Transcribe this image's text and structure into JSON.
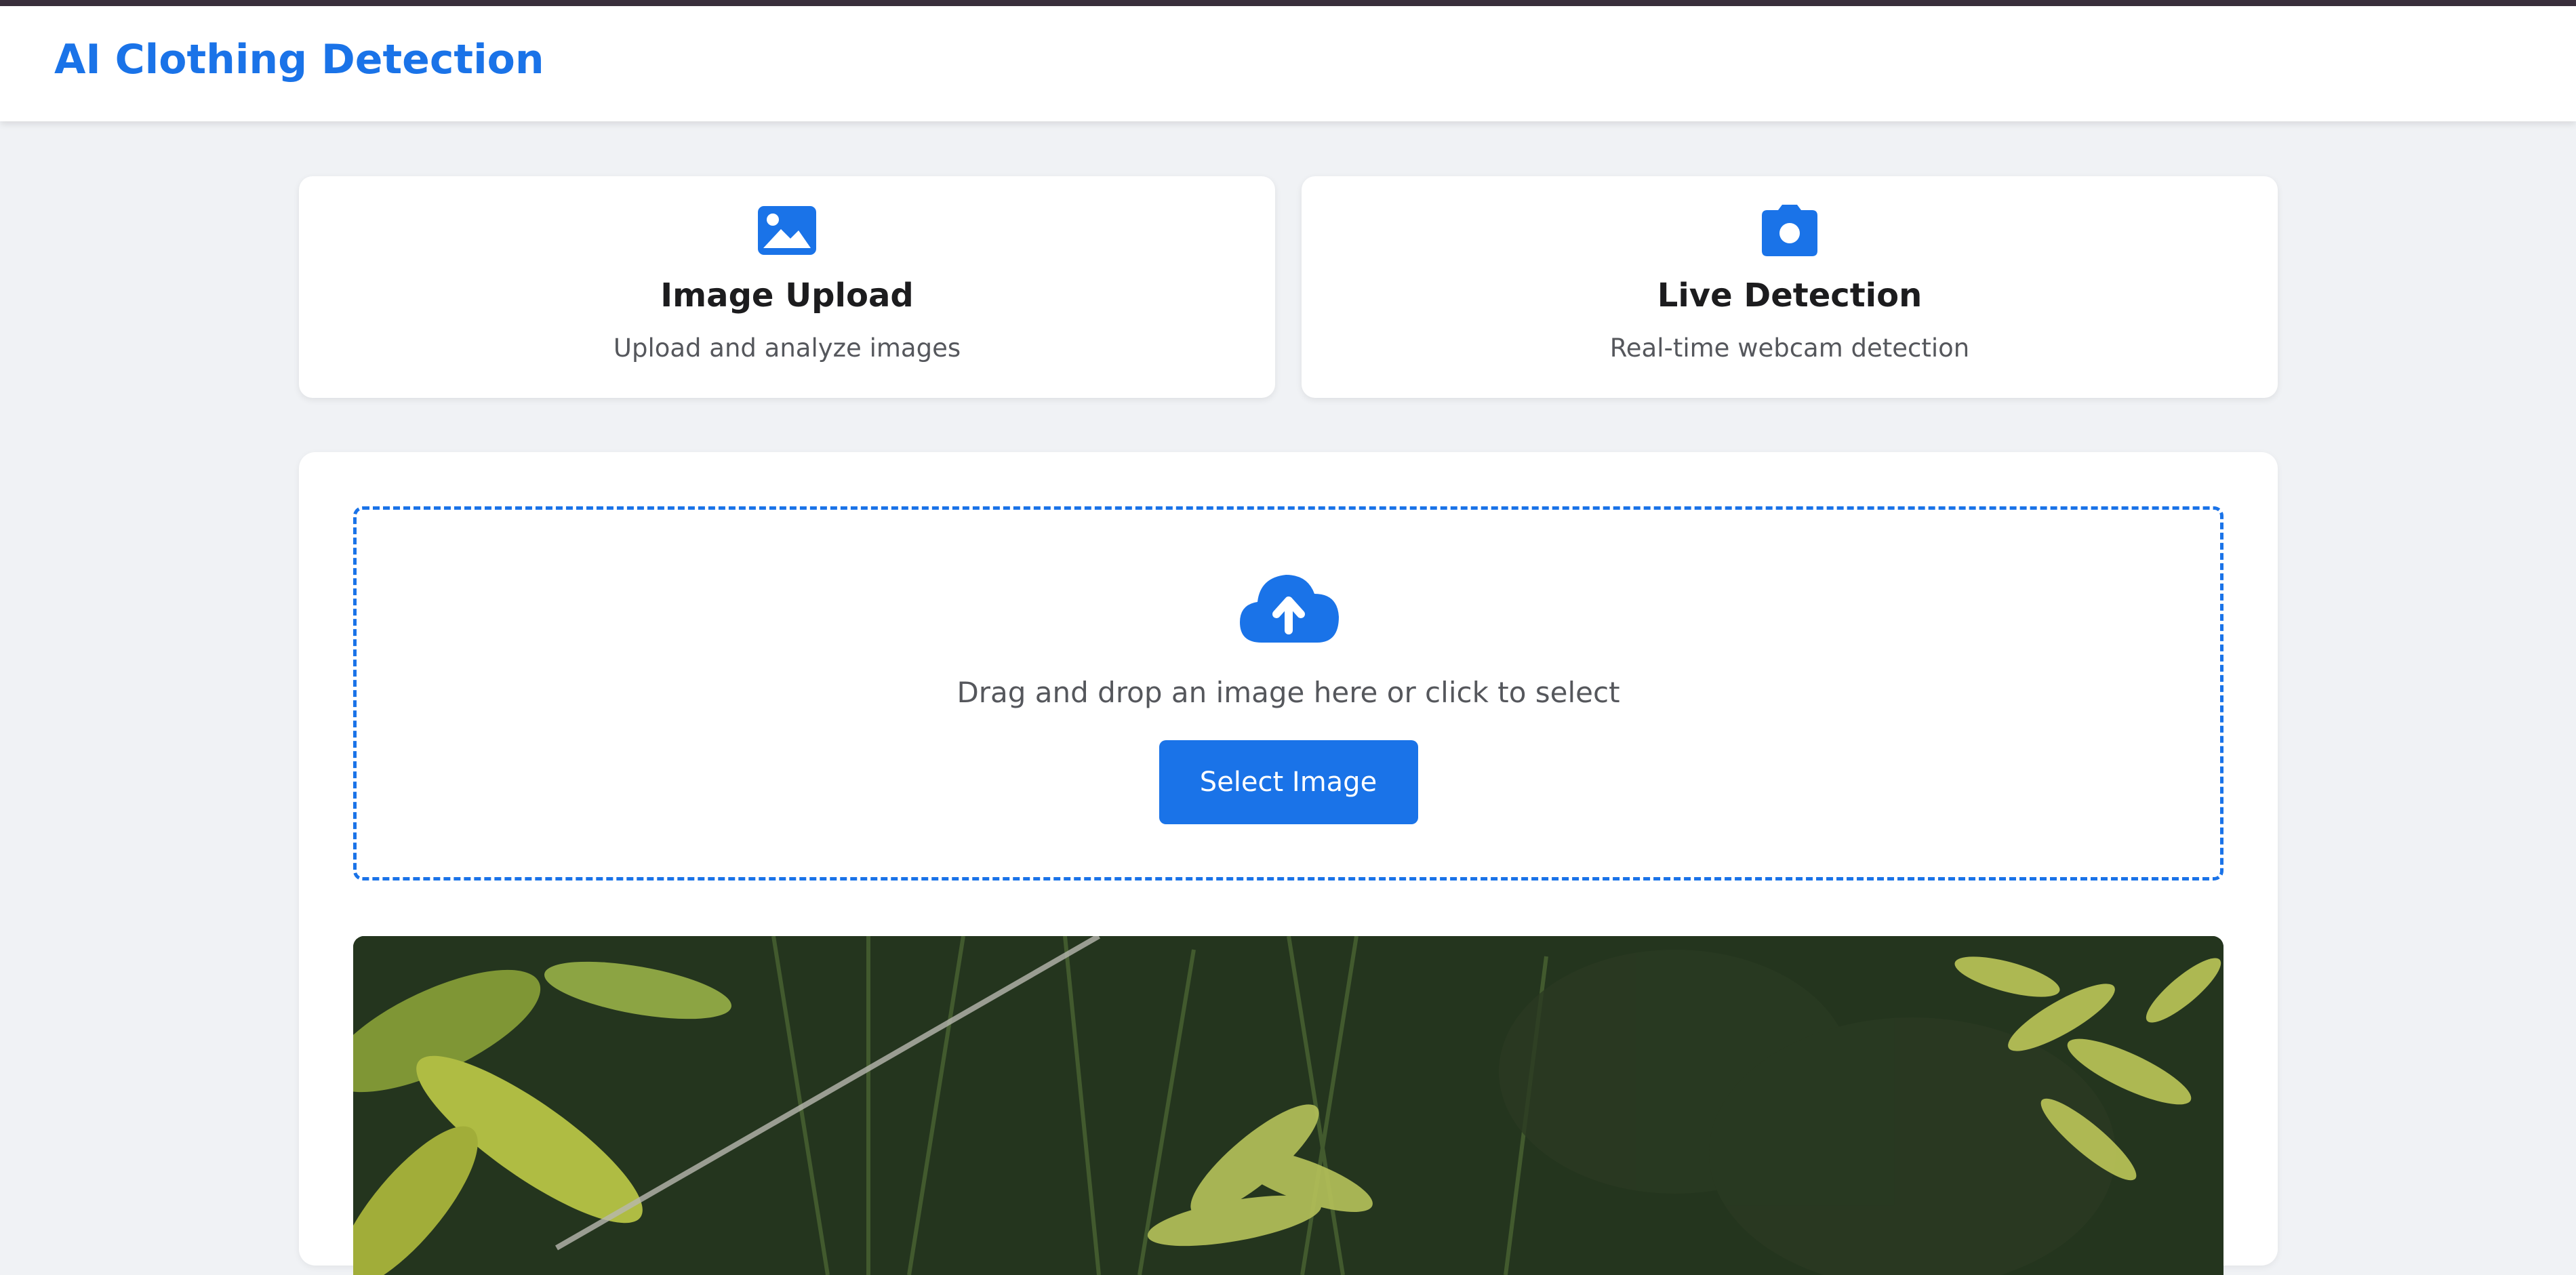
{
  "header": {
    "title": "AI Clothing Detection"
  },
  "modes": [
    {
      "title": "Image Upload",
      "subtitle": "Upload and analyze images",
      "icon": "image-icon"
    },
    {
      "title": "Live Detection",
      "subtitle": "Real-time webcam detection",
      "icon": "camera-icon"
    }
  ],
  "upload": {
    "icon": "cloud-upload-icon",
    "prompt": "Drag and drop an image here or click to select",
    "button_label": "Select Image"
  },
  "colors": {
    "accent": "#1a73e8",
    "background": "#f0f2f5",
    "card": "#ffffff",
    "text": "#1c1c1e",
    "muted_text": "#55575c"
  }
}
